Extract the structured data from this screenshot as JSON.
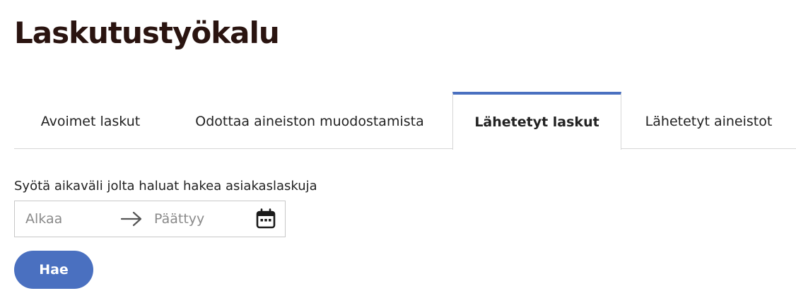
{
  "page": {
    "title": "Laskutustyökalu"
  },
  "tabs": [
    {
      "label": "Avoimet laskut",
      "active": false
    },
    {
      "label": "Odottaa aineiston muodostamista",
      "active": false
    },
    {
      "label": "Lähetetyt laskut",
      "active": true
    },
    {
      "label": "Lähetetyt aineistot",
      "active": false
    }
  ],
  "date_range": {
    "label": "Syötä aikaväli jolta haluat hakea asiakaslaskuja",
    "start_placeholder": "Alkaa",
    "end_placeholder": "Päättyy",
    "start_value": "",
    "end_value": "",
    "separator_icon": "arrow-right-icon",
    "calendar_icon": "calendar-icon"
  },
  "actions": {
    "search_label": "Hae"
  },
  "colors": {
    "accent": "#4a70c0",
    "title": "#2a1410",
    "border": "#d6d6d6"
  }
}
